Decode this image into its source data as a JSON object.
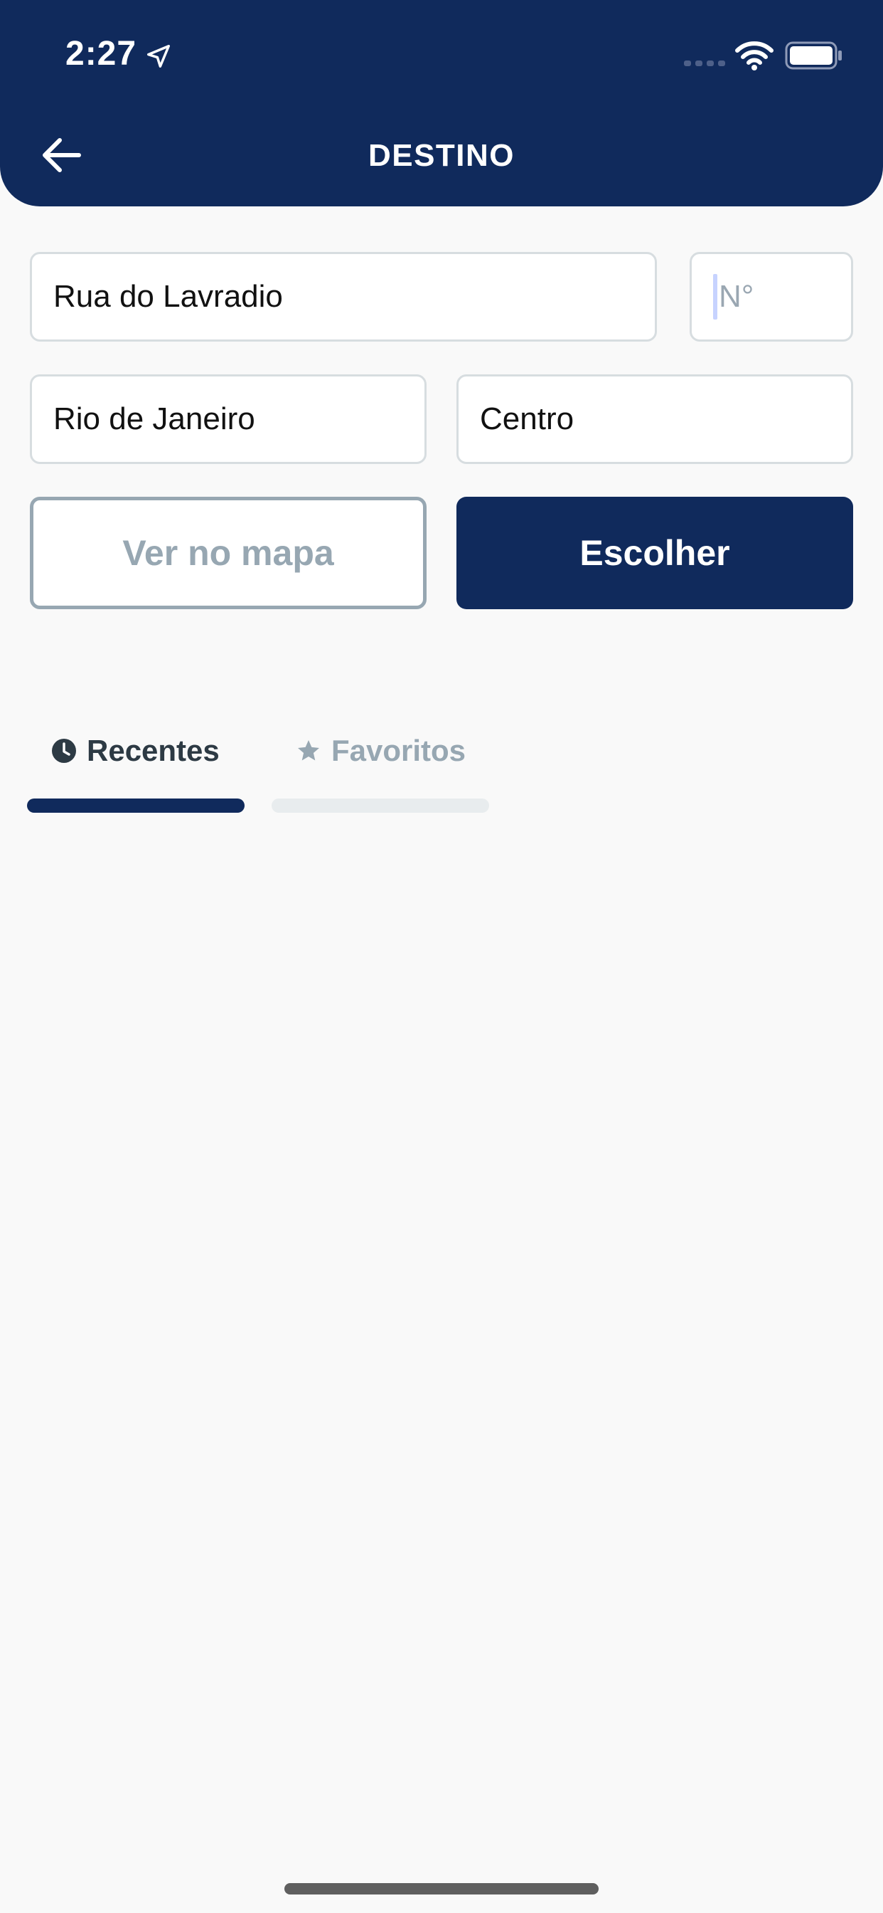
{
  "status_bar": {
    "time": "2:27",
    "icons": [
      "location-arrow-icon",
      "signal-icon",
      "wifi-icon",
      "battery-icon"
    ]
  },
  "header": {
    "title": "DESTINO",
    "back_icon": "arrow-left-icon",
    "background": "#102a5c"
  },
  "form": {
    "street_value": "Rua do Lavradio",
    "number_placeholder": "N°",
    "city_value": "Rio de Janeiro",
    "district_value": "Centro"
  },
  "actions": {
    "map_label": "Ver no mapa",
    "choose_label": "Escolher"
  },
  "tabs": [
    {
      "label": "Recentes",
      "icon": "clock-icon",
      "active": true
    },
    {
      "label": "Favoritos",
      "icon": "star-icon",
      "active": false
    }
  ],
  "colors": {
    "primary": "#102a5c",
    "muted": "#97a7b2",
    "text_dark": "#2d3a44"
  }
}
